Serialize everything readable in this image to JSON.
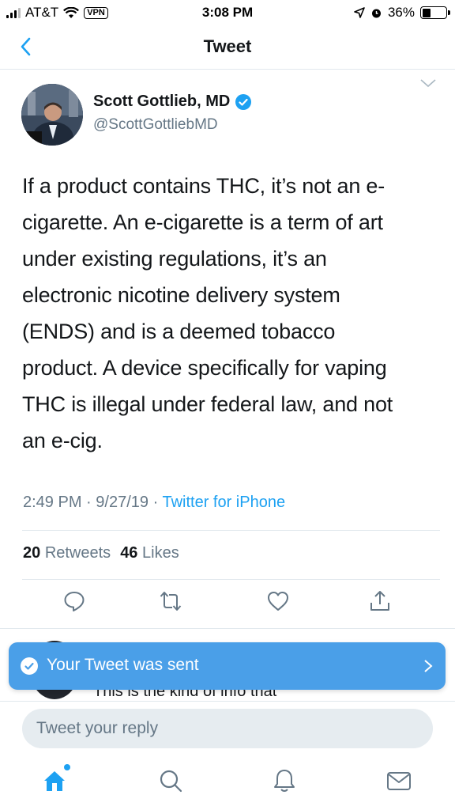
{
  "status_bar": {
    "carrier": "AT&T",
    "vpn": "VPN",
    "time": "3:08 PM",
    "battery": "36%",
    "battery_level": 0.36
  },
  "nav": {
    "title": "Tweet",
    "back_icon": "chevron-left-icon"
  },
  "tweet": {
    "author_name": "Scott Gottlieb, MD",
    "author_handle": "@ScottGottliebMD",
    "verified": true,
    "text_lines": [
      "If a product contains THC, it’s not an e-",
      "cigarette. An e-cigarette is a term of art",
      "under existing regulations, it’s an",
      "electronic nicotine delivery system",
      "(ENDS) and is a deemed tobacco",
      "product. A device specifically for vaping",
      "THC is illegal under federal law, and not",
      "an e-cig."
    ],
    "time": "2:49 PM",
    "date": "9/27/19",
    "separator": "·",
    "source": "Twitter for iPhone",
    "retweets_count": "20",
    "retweets_label": "Retweets",
    "likes_count": "46",
    "likes_label": "Likes"
  },
  "actions": [
    "reply-icon",
    "retweet-icon",
    "like-icon",
    "share-icon"
  ],
  "reply_preview": {
    "snippet": "This is the kind of info that"
  },
  "toast": {
    "message": "Your Tweet was sent"
  },
  "reply_bar": {
    "placeholder": "Tweet your reply"
  },
  "tab_bar": [
    "home-icon",
    "search-icon",
    "notifications-icon",
    "messages-icon"
  ],
  "colors": {
    "accent": "#1da1f2",
    "toast": "#4a9fe8",
    "secondary_text": "#657786",
    "divider": "#e1e8ed"
  }
}
